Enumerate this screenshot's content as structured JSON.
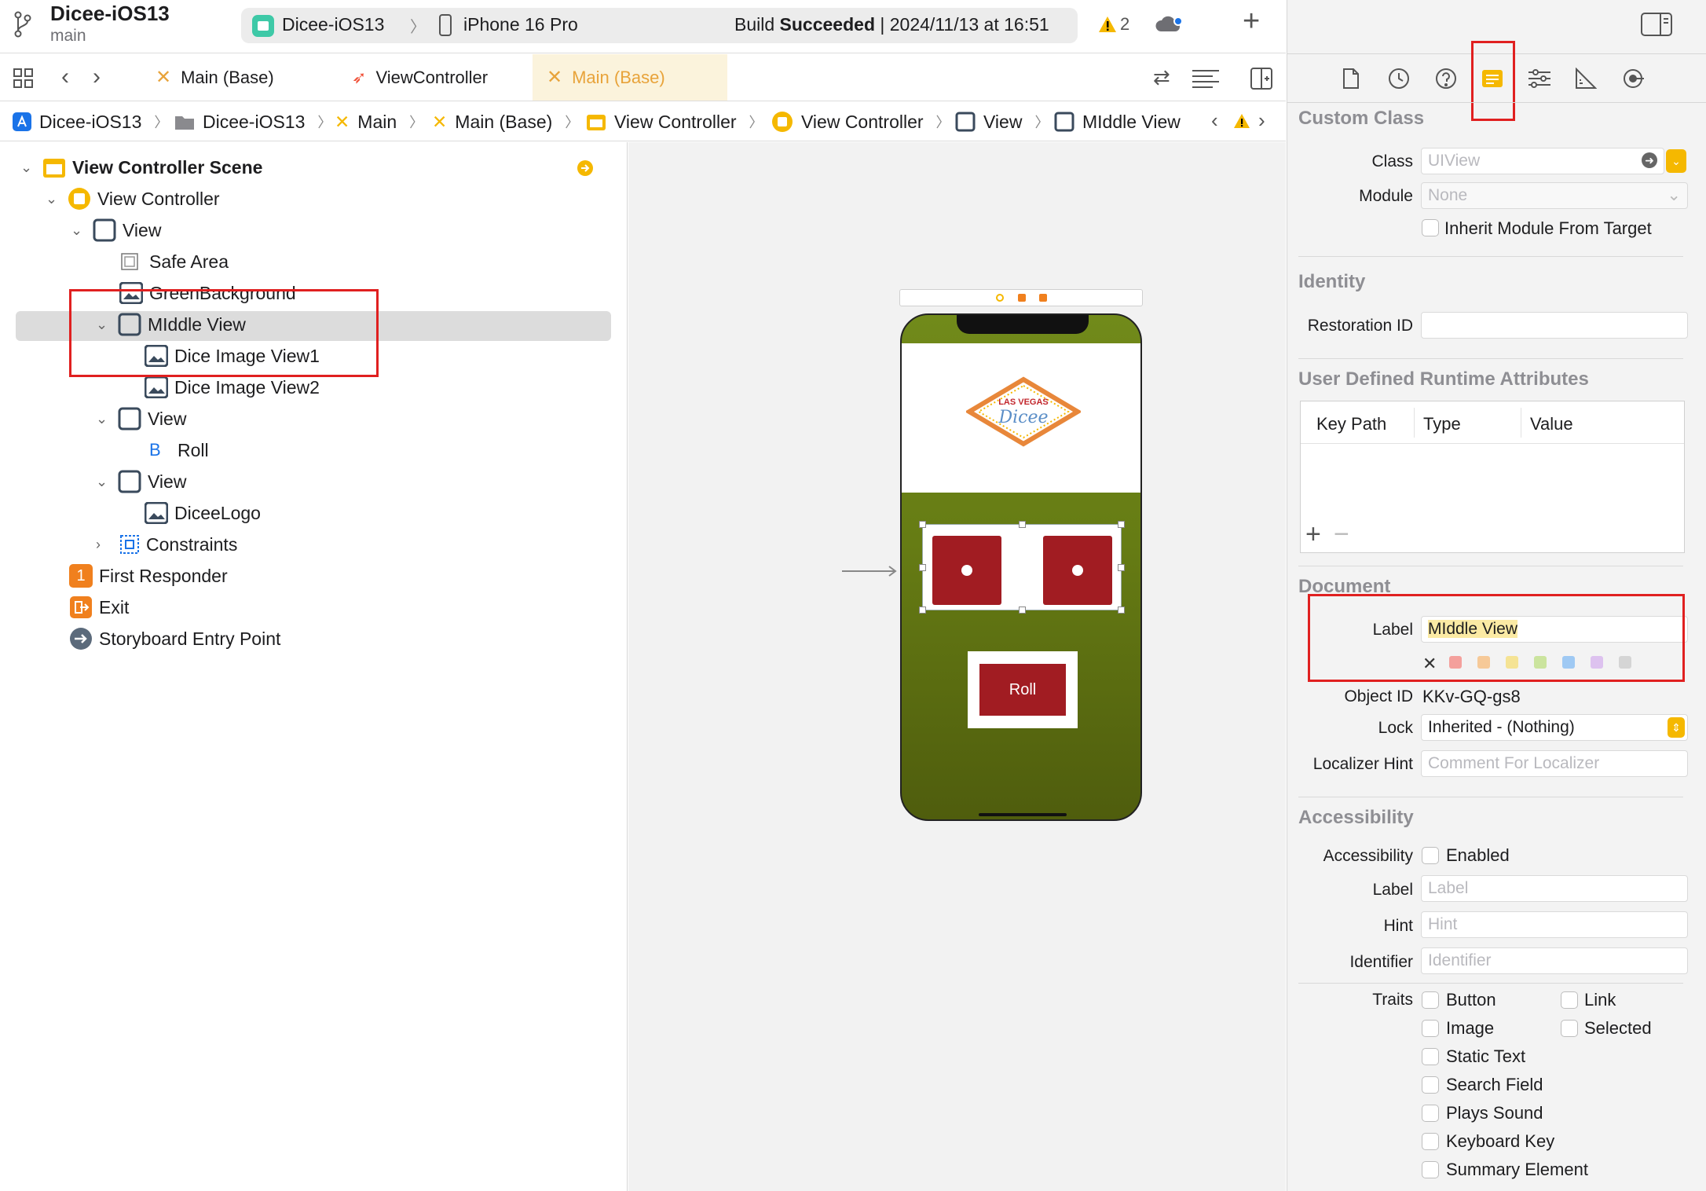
{
  "project": {
    "name": "Dicee-iOS13",
    "branch": "main"
  },
  "scheme": {
    "target": "Dicee-iOS13",
    "device": "iPhone 16 Pro",
    "status_prefix": "Build",
    "status_bold": "Succeeded",
    "status_suffix": "| 2024/11/13 at 16:51",
    "warnings": "2"
  },
  "tabs": [
    {
      "label": "Main (Base)"
    },
    {
      "label": "ViewController"
    },
    {
      "label": "Main (Base)"
    }
  ],
  "jumpbar": [
    "Dicee-iOS13",
    "Dicee-iOS13",
    "Main",
    "Main (Base)",
    "View Controller",
    "View Controller",
    "View",
    "MIddle View"
  ],
  "outline": {
    "scene": "View Controller Scene",
    "vc": "View Controller",
    "view": "View",
    "safe_area": "Safe Area",
    "green_bg": "GreenBackground",
    "middle_view": "MIddle View",
    "dice1": "Dice Image View1",
    "dice2": "Dice Image View2",
    "view2": "View",
    "roll_button_letter": "B",
    "roll": "Roll",
    "view3": "View",
    "dicee_logo": "DiceeLogo",
    "constraints": "Constraints",
    "first_responder": "First Responder",
    "first_responder_badge": "1",
    "exit": "Exit",
    "entry_point": "Storyboard Entry Point"
  },
  "device": {
    "logo_line1": "LAS VEGAS",
    "logo_line2": "Dicee",
    "roll_button": "Roll"
  },
  "inspector": {
    "custom_class_title": "Custom Class",
    "class_label": "Class",
    "class_placeholder": "UIView",
    "module_label": "Module",
    "module_value": "None",
    "inherit_module": "Inherit Module From Target",
    "identity_title": "Identity",
    "restoration_label": "Restoration ID",
    "udra_title": "User Defined Runtime Attributes",
    "col_keypath": "Key Path",
    "col_type": "Type",
    "col_value": "Value",
    "document_title": "Document",
    "doc_label_label": "Label",
    "doc_label_value": "MIddle View",
    "object_id_label": "Object ID",
    "object_id_value": "KKv-GQ-gs8",
    "lock_label": "Lock",
    "lock_value": "Inherited - (Nothing)",
    "localizer_label": "Localizer Hint",
    "localizer_placeholder": "Comment For Localizer",
    "accessibility_title": "Accessibility",
    "acc_label": "Accessibility",
    "acc_enabled": "Enabled",
    "acc_label_label": "Label",
    "acc_label_ph": "Label",
    "hint_label": "Hint",
    "hint_ph": "Hint",
    "identifier_label": "Identifier",
    "identifier_ph": "Identifier",
    "traits_label": "Traits",
    "traits_left": [
      "Button",
      "Image",
      "Static Text",
      "Search Field",
      "Plays Sound",
      "Keyboard Key",
      "Summary Element"
    ],
    "traits_right": [
      "Link",
      "Selected"
    ]
  },
  "colors": {
    "accent": "#f5b800",
    "selection": "#dcdcdc",
    "highlight_red": "#e02020",
    "dice_red": "#a11c22",
    "felt_green": "#6b7d13"
  }
}
